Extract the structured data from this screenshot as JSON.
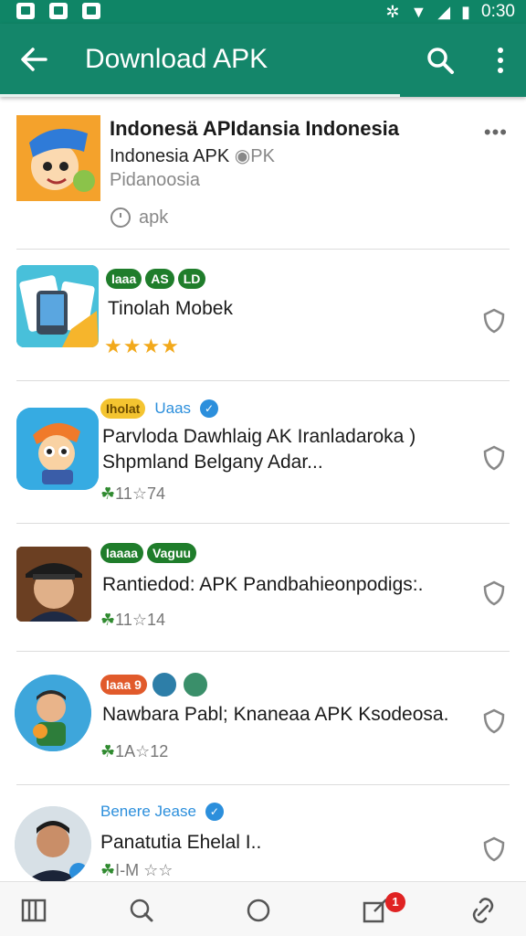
{
  "status_bar": {
    "time": "0:30"
  },
  "app_bar": {
    "title": "Download APK"
  },
  "featured": {
    "title": "Indonesä APIdansia Indonesia",
    "subtitle": "Indonesia APK",
    "subtitle_extra": "PK",
    "developer": "Pidanoosia",
    "size_label": "apk"
  },
  "items": [
    {
      "tags": [
        "Iaaa",
        "AS",
        "LD"
      ],
      "name": "Tinolah Mobek",
      "stars": "★★★★",
      "meta": ""
    },
    {
      "tags": [
        "Iholat",
        "Uaas"
      ],
      "name": "Parvloda Dawhlaig AK Iranladaroka )",
      "desc": "Shpmland Belgany Adar...",
      "meta_icon": "☘",
      "meta": "11☆74"
    },
    {
      "tags": [
        "Iaaaa",
        "Vaguu"
      ],
      "name": "Rantiedod: APK Pandbahieonpodigs:.",
      "meta_icon": "☘",
      "meta": "11☆14"
    },
    {
      "tags": [
        "Iaaa 9"
      ],
      "name": "Nawbara Pabl; Knaneaa APK Ksodeosa.",
      "meta_icon": "☘",
      "meta": "1A☆12"
    },
    {
      "tags": [
        "Benere Jease"
      ],
      "name": "Panatutia Ehelal I..",
      "meta_icon": "☘",
      "meta": "I-M ☆☆"
    }
  ],
  "bottom_nav": {
    "badge_count": "1"
  },
  "colors": {
    "primary": "#14866a",
    "status": "#0f8566",
    "green_badge": "#1f7d2b",
    "orange_badge": "#e15a2b",
    "yellow_badge": "#f4c430",
    "star": "#f2a91c"
  }
}
